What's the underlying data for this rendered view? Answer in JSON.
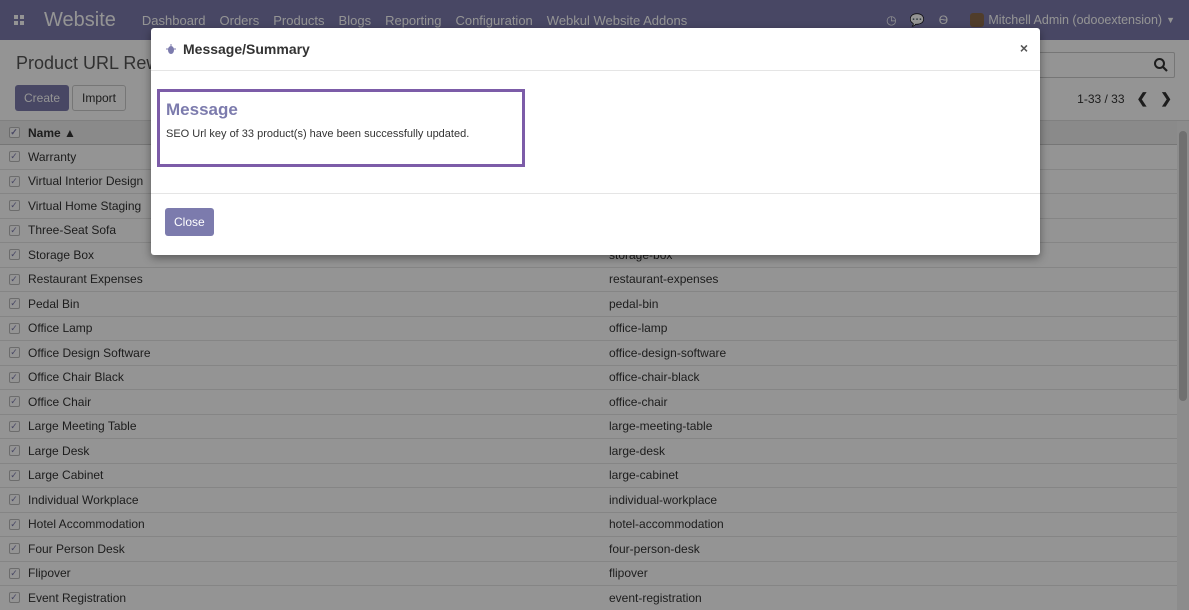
{
  "navbar": {
    "brand": "Website",
    "menu": [
      "Dashboard",
      "Orders",
      "Products",
      "Blogs",
      "Reporting",
      "Configuration",
      "Webkul Website Addons"
    ],
    "user": "Mitchell Admin (odooextension)"
  },
  "control_panel": {
    "breadcrumb": "Product URL Rewr",
    "create_label": "Create",
    "import_label": "Import",
    "pager": "1-33 / 33"
  },
  "table": {
    "header_name": "Name ▲",
    "rows": [
      {
        "name": "Warranty",
        "key": ""
      },
      {
        "name": "Virtual Interior Design",
        "key": ""
      },
      {
        "name": "Virtual Home Staging",
        "key": ""
      },
      {
        "name": "Three-Seat Sofa",
        "key": ""
      },
      {
        "name": "Storage Box",
        "key": "storage-box"
      },
      {
        "name": "Restaurant Expenses",
        "key": "restaurant-expenses"
      },
      {
        "name": "Pedal Bin",
        "key": "pedal-bin"
      },
      {
        "name": "Office Lamp",
        "key": "office-lamp"
      },
      {
        "name": "Office Design Software",
        "key": "office-design-software"
      },
      {
        "name": "Office Chair Black",
        "key": "office-chair-black"
      },
      {
        "name": "Office Chair",
        "key": "office-chair"
      },
      {
        "name": "Large Meeting Table",
        "key": "large-meeting-table"
      },
      {
        "name": "Large Desk",
        "key": "large-desk"
      },
      {
        "name": "Large Cabinet",
        "key": "large-cabinet"
      },
      {
        "name": "Individual Workplace",
        "key": "individual-workplace"
      },
      {
        "name": "Hotel Accommodation",
        "key": "hotel-accommodation"
      },
      {
        "name": "Four Person Desk",
        "key": "four-person-desk"
      },
      {
        "name": "Flipover",
        "key": "flipover"
      },
      {
        "name": "Event Registration",
        "key": "event-registration"
      }
    ]
  },
  "modal": {
    "title": "Message/Summary",
    "close_x": "×",
    "heading": "Message",
    "text": "SEO Url key of 33 product(s) have been successfully updated.",
    "close_button": "Close"
  },
  "colors": {
    "brand": "#7c7bad",
    "message_border": "#7c5ca8"
  }
}
